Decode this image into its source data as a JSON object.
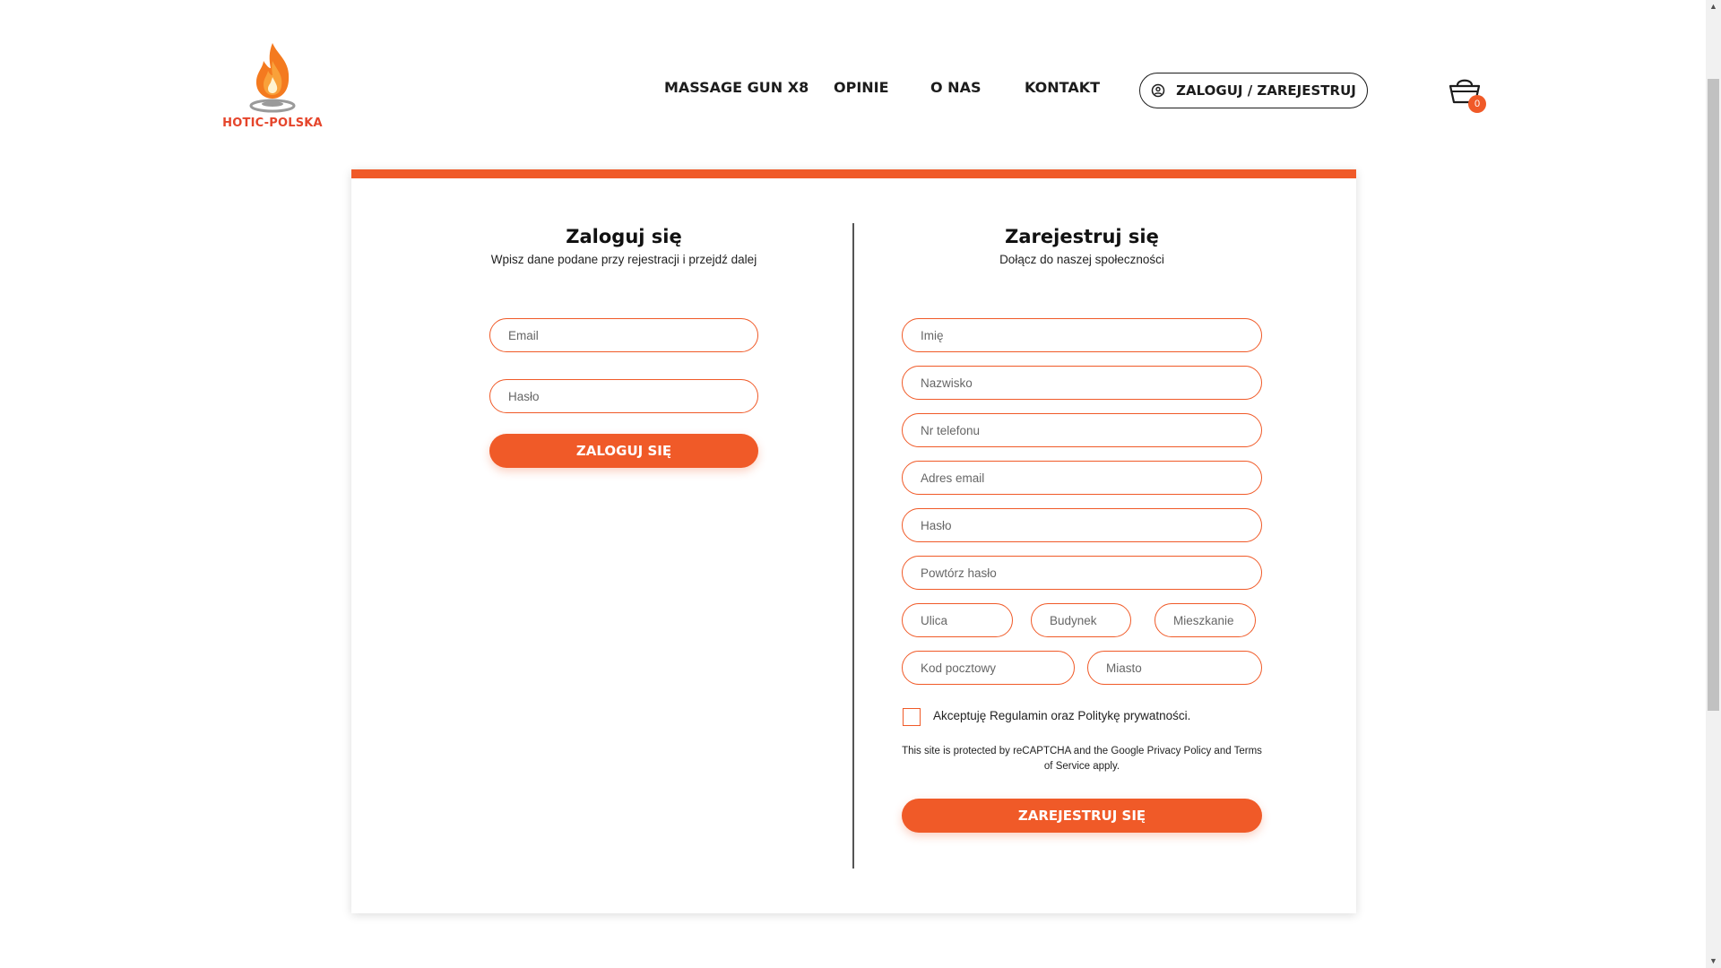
{
  "brand": {
    "logo_text": "HOTIC-POLSKA",
    "accent": "#f05a28"
  },
  "nav": {
    "items": [
      {
        "label": "MASSAGE GUN X8"
      },
      {
        "label": "OPINIE"
      },
      {
        "label": "O NAS"
      },
      {
        "label": "KONTAKT"
      }
    ],
    "login_label": "ZALOGUJ / ZAREJESTRUJ",
    "login_icon": "user-circle-icon",
    "cart_icon": "basket-icon",
    "cart_count": "0"
  },
  "login": {
    "title": "Zaloguj się",
    "subtitle": "Wpisz dane podane przy rejestracji i przejdź dalej",
    "email_placeholder": "Email",
    "password_placeholder": "Hasło",
    "submit_label": "ZALOGUJ SIĘ"
  },
  "register": {
    "title": "Zarejestruj się",
    "subtitle": "Dołącz do naszej społeczności",
    "first_name_placeholder": "Imię",
    "last_name_placeholder": "Nazwisko",
    "phone_placeholder": "Nr telefonu",
    "email_placeholder": "Adres email",
    "password_placeholder": "Hasło",
    "password_repeat_placeholder": "Powtórz hasło",
    "street_placeholder": "Ulica",
    "building_placeholder": "Budynek",
    "apartment_placeholder": "Mieszkanie",
    "postcode_placeholder": "Kod pocztowy",
    "city_placeholder": "Miasto",
    "terms_label": "Akceptuję Regulamin oraz Politykę prywatności.",
    "recaptcha_text": "This site is protected by reCAPTCHA and the Google Privacy Policy and Terms of Service apply.",
    "submit_label": "ZAREJESTRUJ SIĘ"
  }
}
